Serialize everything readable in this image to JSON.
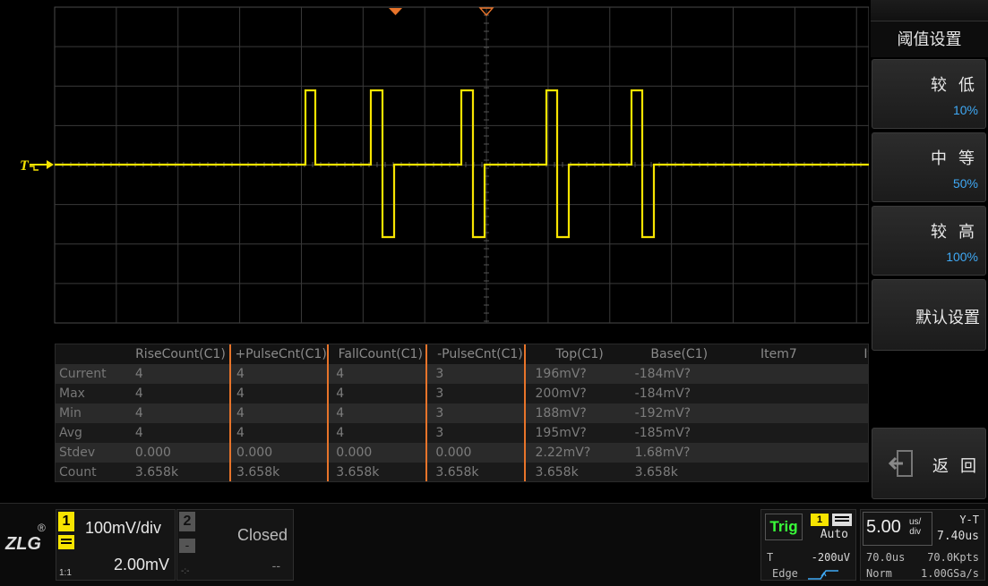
{
  "waveform": {
    "trigger_marker_label": "T",
    "channel_color": "#f7e400",
    "trigger_color": "#e8742a"
  },
  "measurements": {
    "columns": [
      "",
      "RiseCount(C1)",
      "+PulseCnt(C1)",
      "FallCount(C1)",
      "-PulseCnt(C1)",
      "Top(C1)",
      "Base(C1)",
      "Item7",
      "Ite"
    ],
    "rows": [
      {
        "label": "Current",
        "cells": [
          "4",
          "4",
          "4",
          "3",
          "196mV?",
          "-184mV?",
          "",
          ""
        ]
      },
      {
        "label": "Max",
        "cells": [
          "4",
          "4",
          "4",
          "3",
          "200mV?",
          "-184mV?",
          "",
          ""
        ]
      },
      {
        "label": "Min",
        "cells": [
          "4",
          "4",
          "4",
          "3",
          "188mV?",
          "-192mV?",
          "",
          ""
        ]
      },
      {
        "label": "Avg",
        "cells": [
          "4",
          "4",
          "4",
          "3",
          "195mV?",
          "-185mV?",
          "",
          ""
        ]
      },
      {
        "label": "Stdev",
        "cells": [
          "0.000",
          "0.000",
          "0.000",
          "0.000",
          "2.22mV?",
          "1.68mV?",
          "",
          ""
        ]
      },
      {
        "label": "Count",
        "cells": [
          "3.658k",
          "3.658k",
          "3.658k",
          "3.658k",
          "3.658k",
          "3.658k",
          "",
          ""
        ]
      }
    ],
    "highlighted_columns": [
      "+PulseCnt(C1)",
      "-PulseCnt(C1)"
    ],
    "highlight_color": "#e8742a"
  },
  "menu": {
    "title": "阈值设置",
    "buttons": [
      {
        "label": "较 低",
        "value": "10%"
      },
      {
        "label": "中 等",
        "value": "50%"
      },
      {
        "label": "较 高",
        "value": "100%"
      }
    ],
    "default_label": "默认设置",
    "back_label": "返 回"
  },
  "status": {
    "logo": "ZLG",
    "reg": "®",
    "ch1": {
      "number": "1",
      "scale": "100mV/div",
      "offset": "2.00mV",
      "probe": "1:1"
    },
    "ch2": {
      "number": "2",
      "state": "Closed",
      "coupling": "-",
      "dash_left": "-:-",
      "dash_right": "--"
    },
    "trigger": {
      "label": "Trig",
      "source": "1",
      "mode": "Auto",
      "level_label": "T",
      "level": "-200uV",
      "type": "Edge"
    },
    "timebase": {
      "scale": "5.00",
      "unit_top": "us/",
      "unit_bottom": "div",
      "mode": "Y-T",
      "delay": "7.40us",
      "length": "70.0us",
      "points": "70.0Kpts",
      "acq": "Norm",
      "rate": "1.00GSa/s"
    }
  }
}
